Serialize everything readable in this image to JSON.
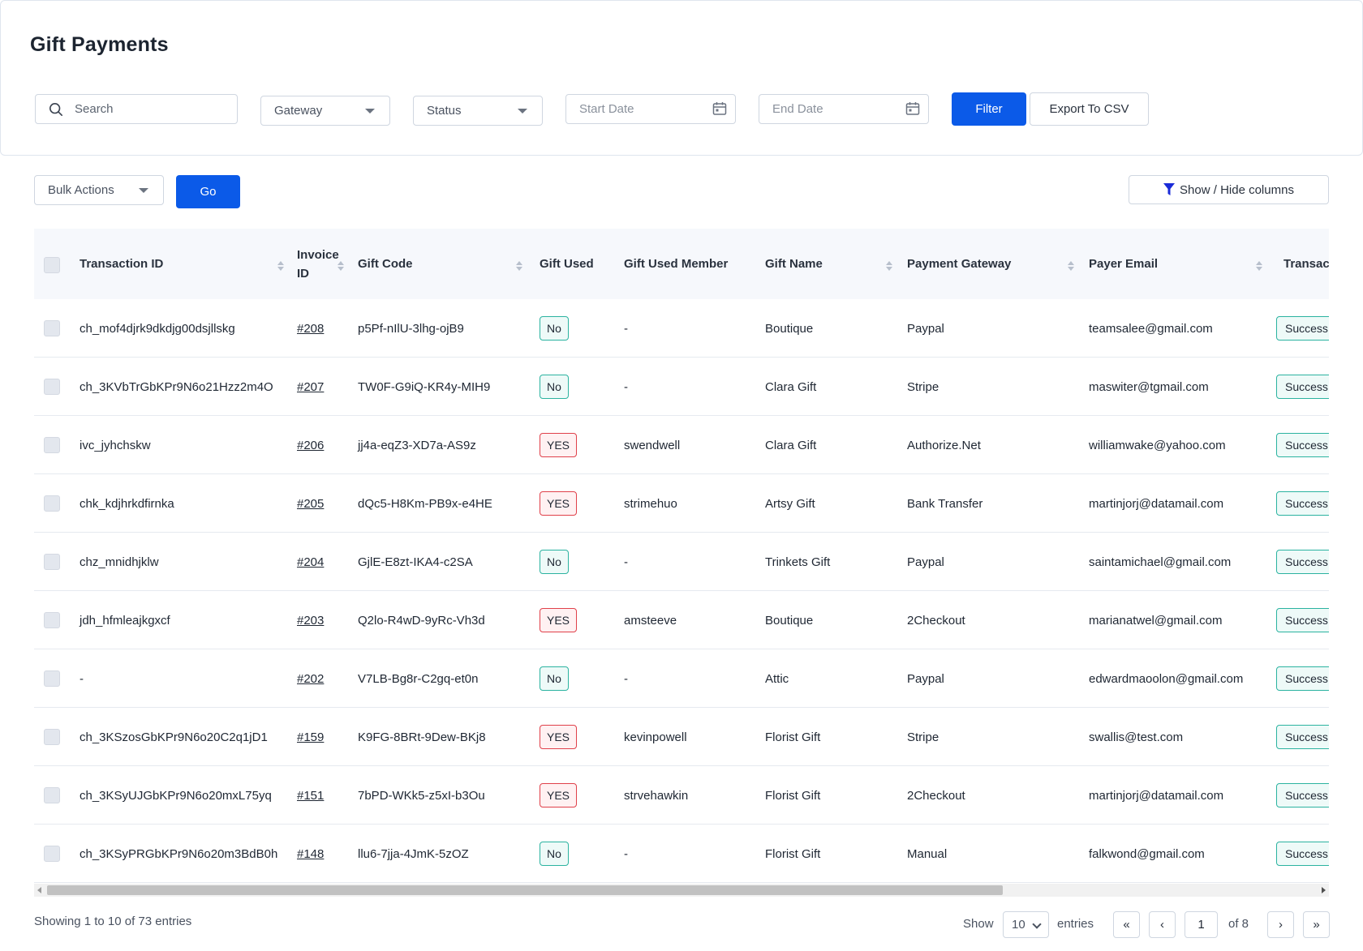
{
  "page": {
    "title": "Gift Payments"
  },
  "filters": {
    "search_placeholder": "Search",
    "gateway_label": "Gateway",
    "status_label": "Status",
    "start_date_placeholder": "Start Date",
    "end_date_placeholder": "End Date",
    "filter_label": "Filter",
    "export_label": "Export To CSV"
  },
  "toolbar": {
    "bulk_actions_label": "Bulk Actions",
    "go_label": "Go",
    "columns_label": "Show / Hide columns"
  },
  "table": {
    "headers": {
      "transaction_id": "Transaction ID",
      "invoice_id_line1": "Invoice",
      "invoice_id_line2": "ID",
      "gift_code": "Gift Code",
      "gift_used": "Gift Used",
      "gift_used_member": "Gift Used Member",
      "gift_name": "Gift Name",
      "payment_gateway": "Payment Gateway",
      "payer_email": "Payer Email",
      "transaction_status": "Transac"
    },
    "rows": [
      {
        "transaction_id": "ch_mof4djrk9dkdjg00dsjllskg",
        "invoice": "#208",
        "gift_code": "p5Pf-nIlU-3lhg-ojB9",
        "gift_used": "No",
        "member": "-",
        "gift_name": "Boutique",
        "gateway": "Paypal",
        "email": "teamsalee@gmail.com",
        "status": "Success"
      },
      {
        "transaction_id": "ch_3KVbTrGbKPr9N6o21Hzz2m4O",
        "invoice": "#207",
        "gift_code": "TW0F-G9iQ-KR4y-MIH9",
        "gift_used": "No",
        "member": "-",
        "gift_name": "Clara Gift",
        "gateway": "Stripe",
        "email": "maswiter@tgmail.com",
        "status": "Success"
      },
      {
        "transaction_id": "ivc_jyhchskw",
        "invoice": "#206",
        "gift_code": "jj4a-eqZ3-XD7a-AS9z",
        "gift_used": "YES",
        "member": "swendwell",
        "gift_name": "Clara Gift",
        "gateway": "Authorize.Net",
        "email": "williamwake@yahoo.com",
        "status": "Success"
      },
      {
        "transaction_id": "chk_kdjhrkdfirnka",
        "invoice": "#205",
        "gift_code": "dQc5-H8Km-PB9x-e4HE",
        "gift_used": "YES",
        "member": "strimehuo",
        "gift_name": "Artsy Gift",
        "gateway": "Bank Transfer",
        "email": "martinjorj@datamail.com",
        "status": "Success"
      },
      {
        "transaction_id": "chz_mnidhjklw",
        "invoice": "#204",
        "gift_code": "GjlE-E8zt-IKA4-c2SA",
        "gift_used": "No",
        "member": "-",
        "gift_name": "Trinkets Gift",
        "gateway": "Paypal",
        "email": "saintamichael@gmail.com",
        "status": "Success"
      },
      {
        "transaction_id": "jdh_hfmleajkgxcf",
        "invoice": "#203",
        "gift_code": "Q2lo-R4wD-9yRc-Vh3d",
        "gift_used": "YES",
        "member": "amsteeve",
        "gift_name": "Boutique",
        "gateway": "2Checkout",
        "email": "marianatwel@gmail.com",
        "status": "Success"
      },
      {
        "transaction_id": "-",
        "invoice": "#202",
        "gift_code": "V7LB-Bg8r-C2gq-et0n",
        "gift_used": "No",
        "member": "-",
        "gift_name": "Attic",
        "gateway": "Paypal",
        "email": "edwardmaoolon@gmail.com",
        "status": "Success"
      },
      {
        "transaction_id": "ch_3KSzosGbKPr9N6o20C2q1jD1",
        "invoice": "#159",
        "gift_code": "K9FG-8BRt-9Dew-BKj8",
        "gift_used": "YES",
        "member": "kevinpowell",
        "gift_name": "Florist Gift",
        "gateway": "Stripe",
        "email": "swallis@test.com",
        "status": "Success"
      },
      {
        "transaction_id": "ch_3KSyUJGbKPr9N6o20mxL75yq",
        "invoice": "#151",
        "gift_code": "7bPD-WKk5-z5xI-b3Ou",
        "gift_used": "YES",
        "member": "strvehawkin",
        "gift_name": "Florist Gift",
        "gateway": "2Checkout",
        "email": "martinjorj@datamail.com",
        "status": "Success"
      },
      {
        "transaction_id": "ch_3KSyPRGbKPr9N6o20m3BdB0h",
        "invoice": "#148",
        "gift_code": "llu6-7jja-4JmK-5zOZ",
        "gift_used": "No",
        "member": "-",
        "gift_name": "Florist Gift",
        "gateway": "Manual",
        "email": "falkwond@gmail.com",
        "status": "Success"
      }
    ]
  },
  "pagination": {
    "info": "Showing 1 to 10 of 73 entries",
    "show_label": "Show",
    "per_page": "10",
    "entries_label": "entries",
    "first": "«",
    "prev": "‹",
    "current_page": "1",
    "of_label": "of 8",
    "next": "›",
    "last": "»"
  },
  "colors": {
    "primary": "#0b5ae8",
    "success_border": "#2bb3a0",
    "danger_border": "#e0404a"
  }
}
